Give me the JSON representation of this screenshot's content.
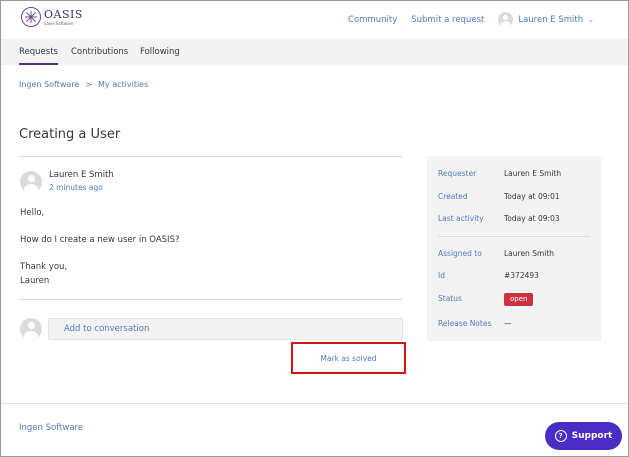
{
  "header": {
    "logo_name": "OASIS",
    "logo_sub": "Sales Software",
    "nav": [
      "Community",
      "Submit a request"
    ],
    "user_name": "Lauren E Smith",
    "chevron": "chevron-down-icon"
  },
  "tabs": [
    "Requests",
    "Contributions",
    "Following"
  ],
  "breadcrumb": {
    "items": [
      "Ingen Software",
      "My activities"
    ],
    "separator": ">"
  },
  "request": {
    "title": "Creating a User",
    "author": "Lauren E Smith",
    "timestamp": "2 minutes ago",
    "body": [
      "Hello,",
      "How do I create a new user in OASIS?",
      "Thank you,",
      "Lauren"
    ]
  },
  "reply": {
    "placeholder": "Add to conversation"
  },
  "actions": {
    "mark_solved": "Mark as solved"
  },
  "details": {
    "requester_label": "Requester",
    "requester": "Lauren E Smith",
    "created_label": "Created",
    "created": "Today at 09:01",
    "last_activity_label": "Last activity",
    "last_activity": "Today at 09:03",
    "assigned_label": "Assigned to",
    "assigned": "Lauren Smith",
    "id_label": "Id",
    "id": "#372493",
    "status_label": "Status",
    "status": "open",
    "release_notes_label": "Release Notes",
    "release_notes": "—"
  },
  "footer": {
    "link": "Ingen Software"
  },
  "support": {
    "label": "Support",
    "icon": "question-icon"
  },
  "colors": {
    "accent": "#5a2f8c",
    "link": "#4e7bb8",
    "status_open": "#cc3340",
    "support_bg": "#4b2cc4",
    "highlight": "#d01616"
  }
}
